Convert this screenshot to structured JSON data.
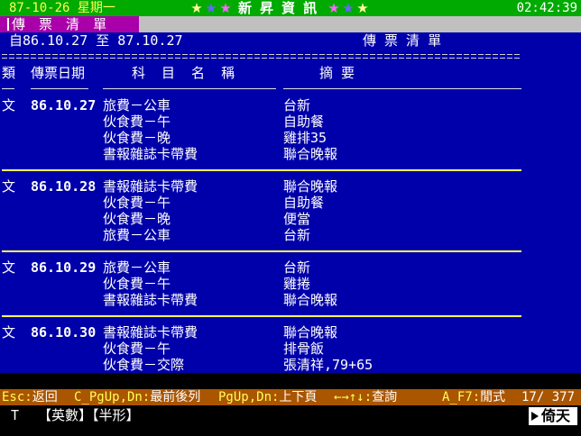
{
  "colors": {
    "top_bar_bg": "#00aa00",
    "tab_bg": "#aa00aa",
    "tab_row_bg": "#c0c0c0",
    "main_bg": "#0000aa",
    "group_separator": "#ffff55",
    "status_bar_bg": "#aa5500",
    "status_key": "#ffff55",
    "bottom_bar_bg": "#000000"
  },
  "top_bar": {
    "date": "87-10-26 星期一",
    "brand": "新 昇 資 訊",
    "time": "02:42:39",
    "stars_left": [
      {
        "icon": "star-icon",
        "color": "#ffff99"
      },
      {
        "icon": "star-icon",
        "color": "#6666ff"
      },
      {
        "icon": "star-icon",
        "color": "#ff66ff"
      }
    ],
    "stars_right": [
      {
        "icon": "star-icon",
        "color": "#ff66ff"
      },
      {
        "icon": "star-icon",
        "color": "#6666ff"
      },
      {
        "icon": "star-icon",
        "color": "#ffff99"
      }
    ]
  },
  "tab": {
    "label": "傳 票 清 單"
  },
  "report": {
    "date_range": "自86.10.27 至 87.10.27",
    "title": "傳 票 清 單"
  },
  "columns": {
    "type": "類",
    "date": "傳票日期",
    "account": "科 目 名 稱",
    "summary": "摘 要"
  },
  "vouchers": [
    {
      "type": "文",
      "date": "86.10.27",
      "entries": [
        {
          "account": "旅費－公車",
          "summary": "台新"
        },
        {
          "account": "伙食費－午",
          "summary": "自助餐"
        },
        {
          "account": "伙食費－晚",
          "summary": "雞排35"
        },
        {
          "account": "書報雜誌卡帶費",
          "summary": "聯合晚報"
        }
      ]
    },
    {
      "type": "文",
      "date": "86.10.28",
      "entries": [
        {
          "account": "書報雜誌卡帶費",
          "summary": "聯合晚報"
        },
        {
          "account": "伙食費－午",
          "summary": "自助餐"
        },
        {
          "account": "伙食費－晚",
          "summary": "便當"
        },
        {
          "account": "旅費－公車",
          "summary": "台新"
        }
      ]
    },
    {
      "type": "文",
      "date": "86.10.29",
      "entries": [
        {
          "account": "旅費－公車",
          "summary": "台新"
        },
        {
          "account": "伙食費－午",
          "summary": "雞捲"
        },
        {
          "account": "書報雜誌卡帶費",
          "summary": "聯合晚報"
        }
      ]
    },
    {
      "type": "文",
      "date": "86.10.30",
      "entries": [
        {
          "account": "書報雜誌卡帶費",
          "summary": "聯合晚報"
        },
        {
          "account": "伙食費－午",
          "summary": "排骨飯"
        },
        {
          "account": "伙食費－交際",
          "summary": "張清祥,79+65"
        }
      ]
    }
  ],
  "status_bar": {
    "hints": [
      {
        "key": "Esc:",
        "label": "返回"
      },
      {
        "key": "C_PgUp,Dn:",
        "label": "最前後列"
      },
      {
        "key": "PgUp,Dn:",
        "label": "上下頁"
      },
      {
        "key": "←→↑↓:",
        "label": "查詢"
      },
      {
        "key": "A_F7:",
        "label": "閒式"
      }
    ],
    "record_position": "17/ 377"
  },
  "input_bar": {
    "input_method": "T",
    "modes": [
      "【英數】",
      "【半形】"
    ],
    "logo": "倚天"
  }
}
